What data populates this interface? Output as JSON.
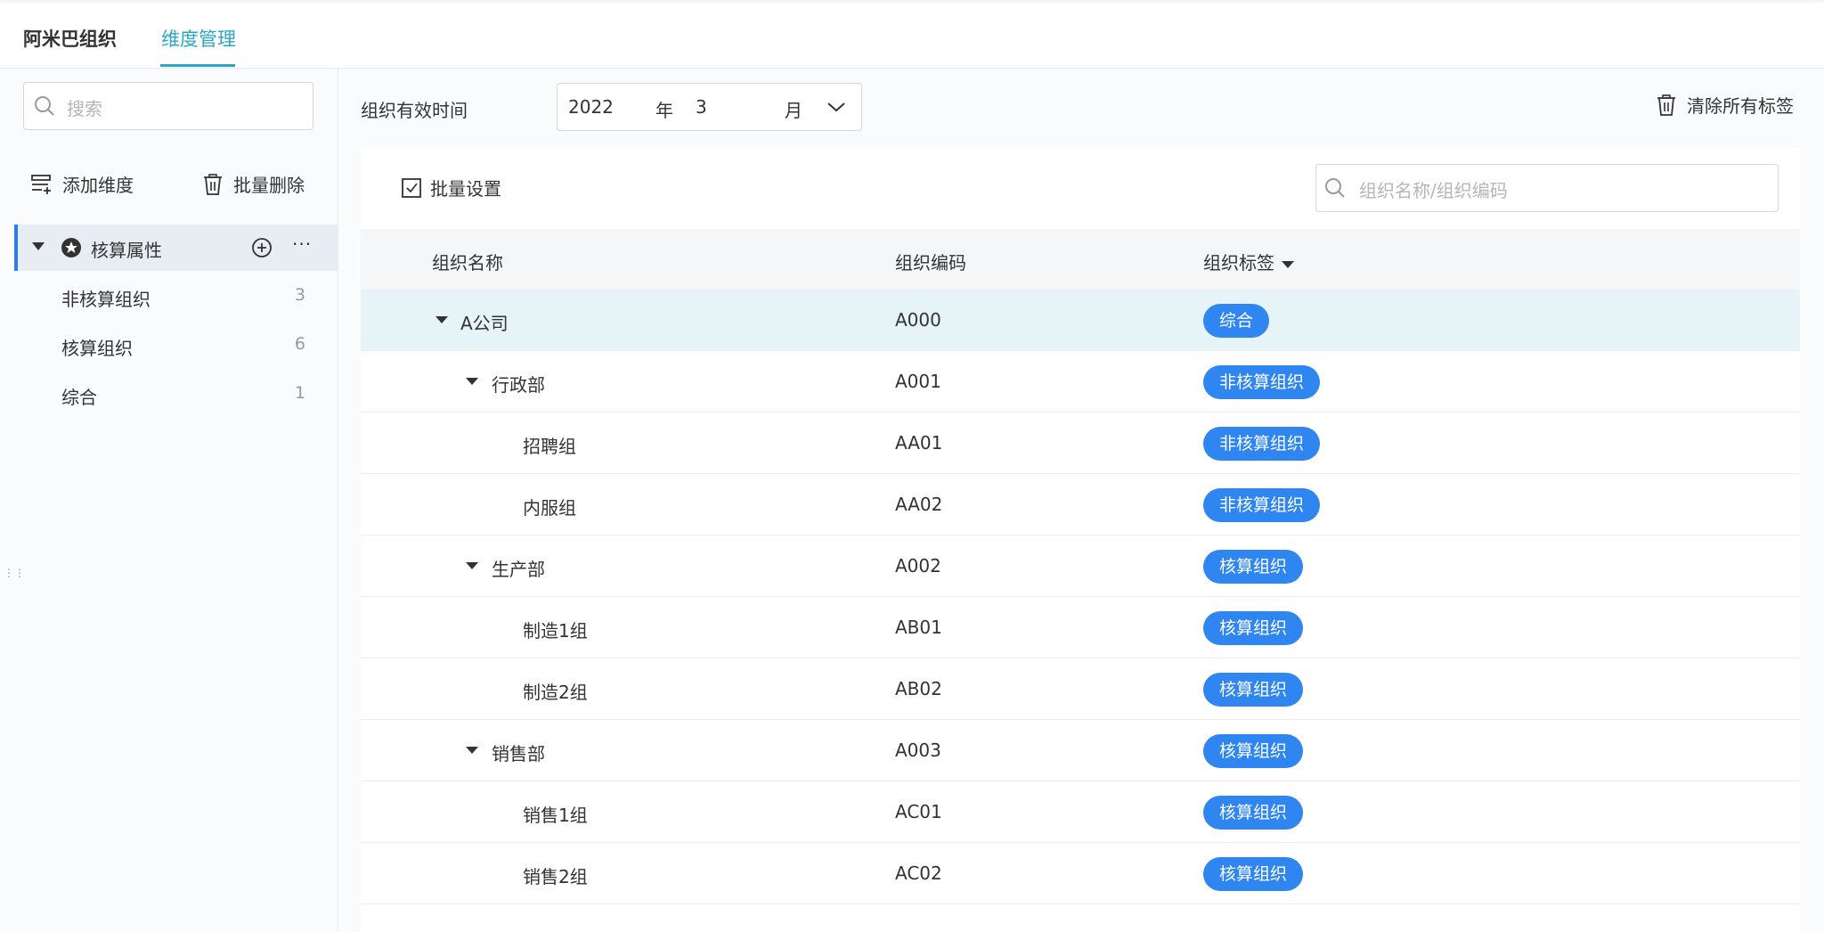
{
  "tabs": [
    {
      "label": "阿米巴组织"
    },
    {
      "label": "维度管理"
    }
  ],
  "sidebar": {
    "search_placeholder": "搜索",
    "add_label": "添加维度",
    "delete_label": "批量删除",
    "root": {
      "label": "核算属性"
    },
    "items": [
      {
        "label": "非核算组织",
        "count": "3"
      },
      {
        "label": "核算组织",
        "count": "6"
      },
      {
        "label": "综合",
        "count": "1"
      }
    ]
  },
  "filter": {
    "valid_time_label": "组织有效时间",
    "year": "2022",
    "year_unit": "年",
    "month": "3",
    "month_unit": "月",
    "clear_label": "清除所有标签"
  },
  "panel": {
    "batch_label": "批量设置",
    "search_placeholder": "组织名称/组织编码"
  },
  "table": {
    "headers": {
      "name": "组织名称",
      "code": "组织编码",
      "tag": "组织标签"
    },
    "rows": [
      {
        "name": "A公司",
        "code": "A000",
        "tag": "综合"
      },
      {
        "name": "行政部",
        "code": "A001",
        "tag": "非核算组织"
      },
      {
        "name": "招聘组",
        "code": "AA01",
        "tag": "非核算组织"
      },
      {
        "name": "内服组",
        "code": "AA02",
        "tag": "非核算组织"
      },
      {
        "name": "生产部",
        "code": "A002",
        "tag": "核算组织"
      },
      {
        "name": "制造1组",
        "code": "AB01",
        "tag": "核算组织"
      },
      {
        "name": "制造2组",
        "code": "AB02",
        "tag": "核算组织"
      },
      {
        "name": "销售部",
        "code": "A003",
        "tag": "核算组织"
      },
      {
        "name": "销售1组",
        "code": "AC01",
        "tag": "核算组织"
      },
      {
        "name": "销售2组",
        "code": "AC02",
        "tag": "核算组织"
      }
    ]
  },
  "colors": {
    "accent": "#2aa7c7",
    "tag_bg": "#2f86f0",
    "selected_row": "#e6f3f7"
  }
}
